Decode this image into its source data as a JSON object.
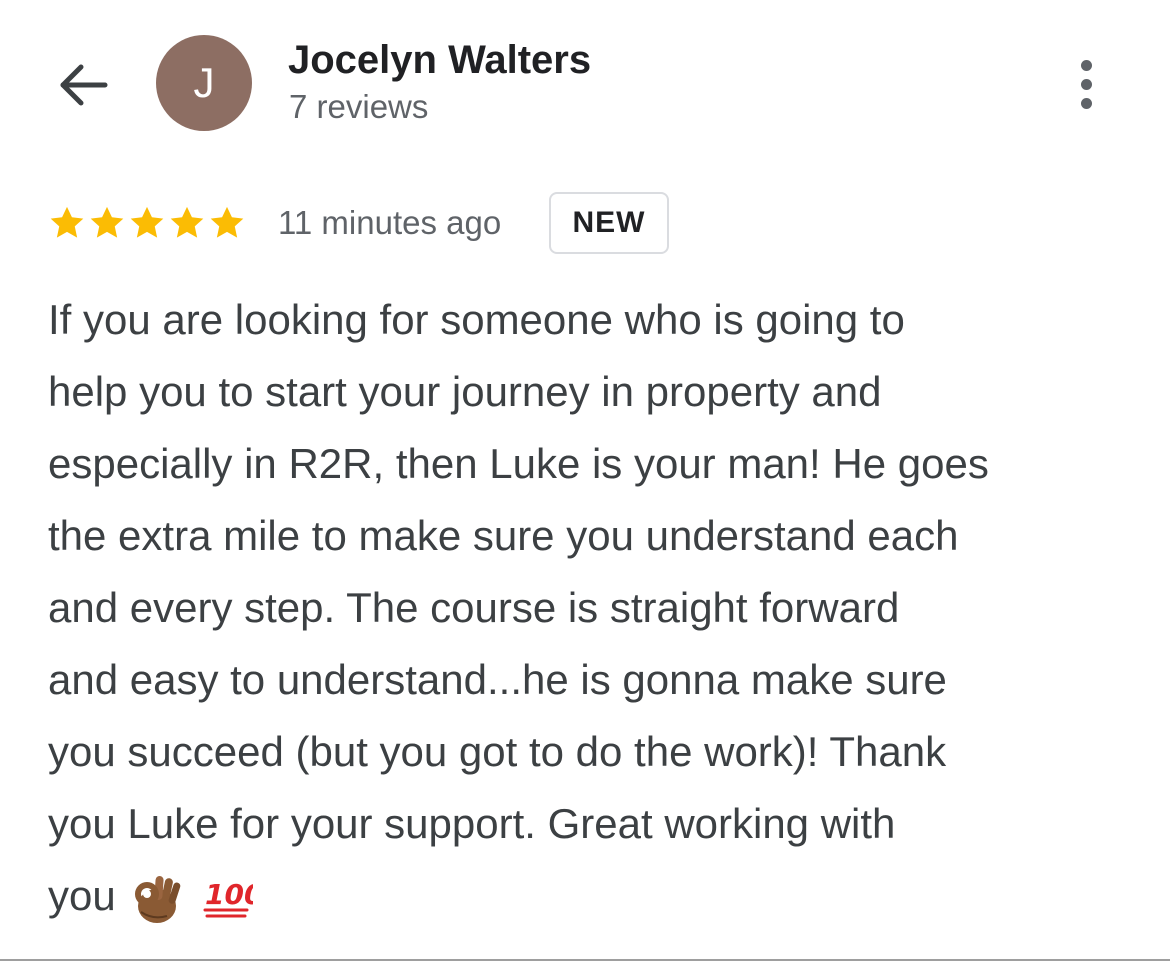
{
  "header": {
    "back_icon": "arrow-left-icon",
    "avatar_initial": "J",
    "avatar_color": "#8d6e63",
    "author_name": "Jocelyn Walters",
    "review_count": "7 reviews",
    "more_icon": "more-vertical-icon"
  },
  "review": {
    "rating": 5,
    "rating_max": 5,
    "star_color": "#fbbc04",
    "timestamp": "11 minutes ago",
    "badge": "NEW",
    "text_lines": [
      "If you are looking for someone who is going to",
      "help you to start your journey in property and",
      "especially in R2R, then Luke is your man! He goes",
      "the extra mile to make sure you understand each",
      "and every step. The course is straight forward",
      "and easy to understand...he is gonna make sure",
      "you succeed (but you got to do the work)! Thank",
      "you Luke for your support. Great working with",
      "you"
    ],
    "emojis": [
      "ok-hand-emoji",
      "hundred-points-emoji"
    ]
  }
}
